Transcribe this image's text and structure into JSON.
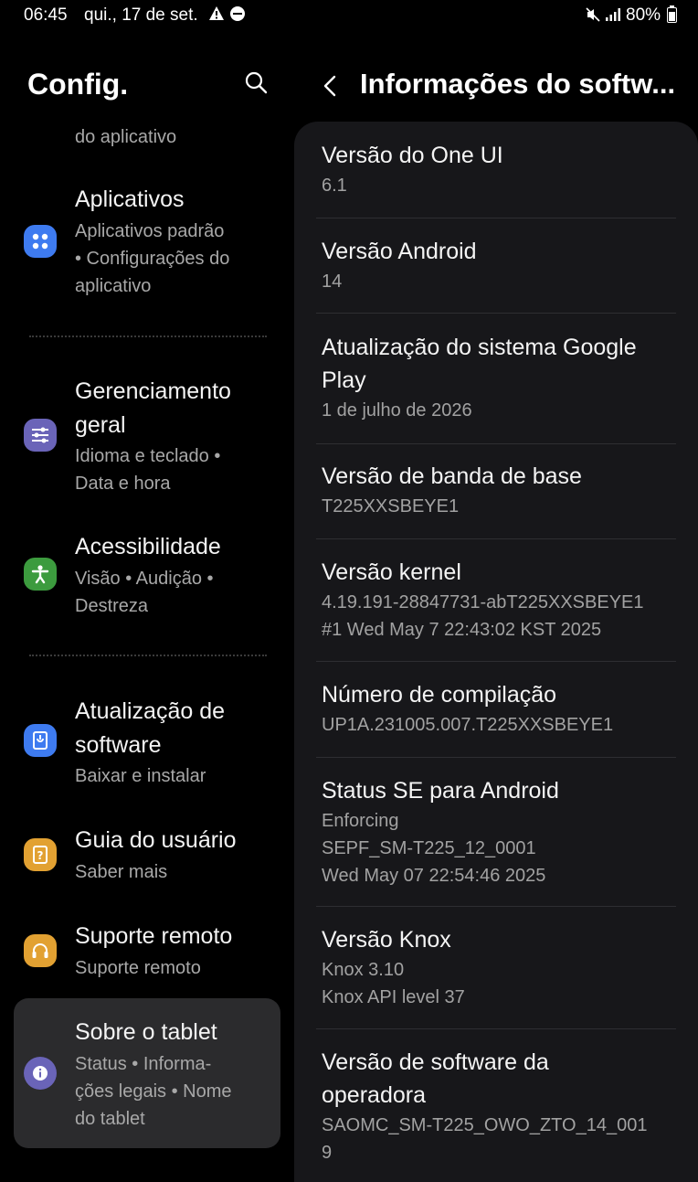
{
  "status_bar": {
    "time": "06:45",
    "date": "qui., 17 de set.",
    "battery": "80%"
  },
  "left": {
    "title": "Config.",
    "partial_item_subtitle": "do aplicativo",
    "items": [
      {
        "icon": "apps-icon",
        "color": "#3e7bf0",
        "title": "Aplicativos",
        "subtitle_lines": [
          "Aplicativos padrão",
          "• Configurações do",
          "aplicativo"
        ]
      },
      {
        "icon": "sliders-icon",
        "color": "#6a64b8",
        "title_lines": [
          "Gerenciamento",
          "geral"
        ],
        "subtitle_lines": [
          "Idioma e teclado •",
          "Data e hora"
        ]
      },
      {
        "icon": "accessibility-icon",
        "color": "#3c9b3e",
        "title": "Acessibilidade",
        "subtitle_lines": [
          "Visão • Audição •",
          "Destreza"
        ]
      },
      {
        "icon": "software-update-icon",
        "color": "#3e7bf0",
        "title_lines": [
          "Atualização de",
          "software"
        ],
        "subtitle_lines": [
          "Baixar e instalar"
        ]
      },
      {
        "icon": "user-guide-icon",
        "color": "#e2a132",
        "title": "Guia do usuário",
        "subtitle_lines": [
          "Saber mais"
        ]
      },
      {
        "icon": "headset-icon",
        "color": "#e2a132",
        "title": "Suporte remoto",
        "subtitle_lines": [
          "Suporte remoto"
        ]
      },
      {
        "icon": "info-icon",
        "color": "#6a64b8",
        "title": "Sobre o tablet",
        "subtitle_lines": [
          "Status • Informa-",
          "ções legais • Nome",
          "do tablet"
        ]
      }
    ]
  },
  "right": {
    "title": "Informações do softw...",
    "rows": [
      {
        "title_lines": [
          "Versão do One UI"
        ],
        "value_lines": [
          "6.1"
        ]
      },
      {
        "title_lines": [
          "Versão Android"
        ],
        "value_lines": [
          "14"
        ]
      },
      {
        "title_lines": [
          "Atualização do sistema Google",
          "Play"
        ],
        "value_lines": [
          "1 de julho de 2026"
        ]
      },
      {
        "title_lines": [
          "Versão de banda de base"
        ],
        "value_lines": [
          "T225XXSBEYE1"
        ]
      },
      {
        "title_lines": [
          "Versão kernel"
        ],
        "value_lines": [
          "4.19.191-28847731-abT225XXSBEYE1",
          "#1 Wed May 7 22:43:02 KST 2025"
        ]
      },
      {
        "title_lines": [
          "Número de compilação"
        ],
        "value_lines": [
          "UP1A.231005.007.T225XXSBEYE1"
        ]
      },
      {
        "title_lines": [
          "Status SE para Android"
        ],
        "value_lines": [
          "Enforcing",
          "SEPF_SM-T225_12_0001",
          "Wed May 07 22:54:46 2025"
        ]
      },
      {
        "title_lines": [
          "Versão Knox"
        ],
        "value_lines": [
          "Knox 3.10",
          "Knox API level 37"
        ]
      },
      {
        "title_lines": [
          "Versão de software da",
          "operadora"
        ],
        "value_lines": [
          "SAOMC_SM-T225_OWO_ZTO_14_001",
          "9"
        ]
      }
    ]
  }
}
